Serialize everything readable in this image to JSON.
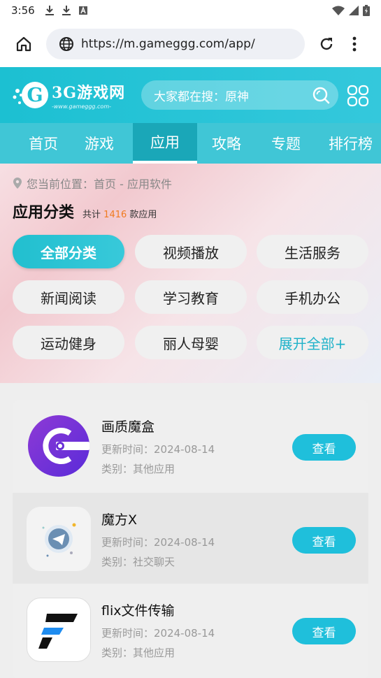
{
  "status_bar": {
    "time": "3:56"
  },
  "browser": {
    "url": "https://m.gameggg.com/app/"
  },
  "header": {
    "logo_title": "3G游戏网",
    "logo_sub": "-www.gameggg.com-",
    "search_placeholder": "大家都在搜：原神"
  },
  "nav": {
    "tabs": [
      {
        "label": "首页"
      },
      {
        "label": "游戏"
      },
      {
        "label": "应用"
      },
      {
        "label": "攻略"
      },
      {
        "label": "专题"
      },
      {
        "label": "排行榜"
      }
    ],
    "active_index": 2
  },
  "breadcrumb": {
    "text": "您当前位置：首页 - 应用软件"
  },
  "category_section": {
    "title": "应用分类",
    "count_prefix": "共计",
    "count": "1416",
    "count_suffix": "款应用",
    "buttons": [
      {
        "label": "全部分类"
      },
      {
        "label": "视频播放"
      },
      {
        "label": "生活服务"
      },
      {
        "label": "新闻阅读"
      },
      {
        "label": "学习教育"
      },
      {
        "label": "手机办公"
      },
      {
        "label": "运动健身"
      },
      {
        "label": "丽人母婴"
      },
      {
        "label": "展开全部+"
      }
    ]
  },
  "apps": [
    {
      "name": "画质魔盒",
      "date": "更新时间：2024-08-14",
      "category": "类别：其他应用",
      "action": "查看"
    },
    {
      "name": "魔方X",
      "date": "更新时间：2024-08-14",
      "category": "类别：社交聊天",
      "action": "查看"
    },
    {
      "name": "flix文件传输",
      "date": "更新时间：2024-08-14",
      "category": "类别：其他应用",
      "action": "查看"
    }
  ],
  "colors": {
    "accent": "#1fbfdb",
    "header": "#1cc0d2",
    "count": "#f07b20"
  }
}
